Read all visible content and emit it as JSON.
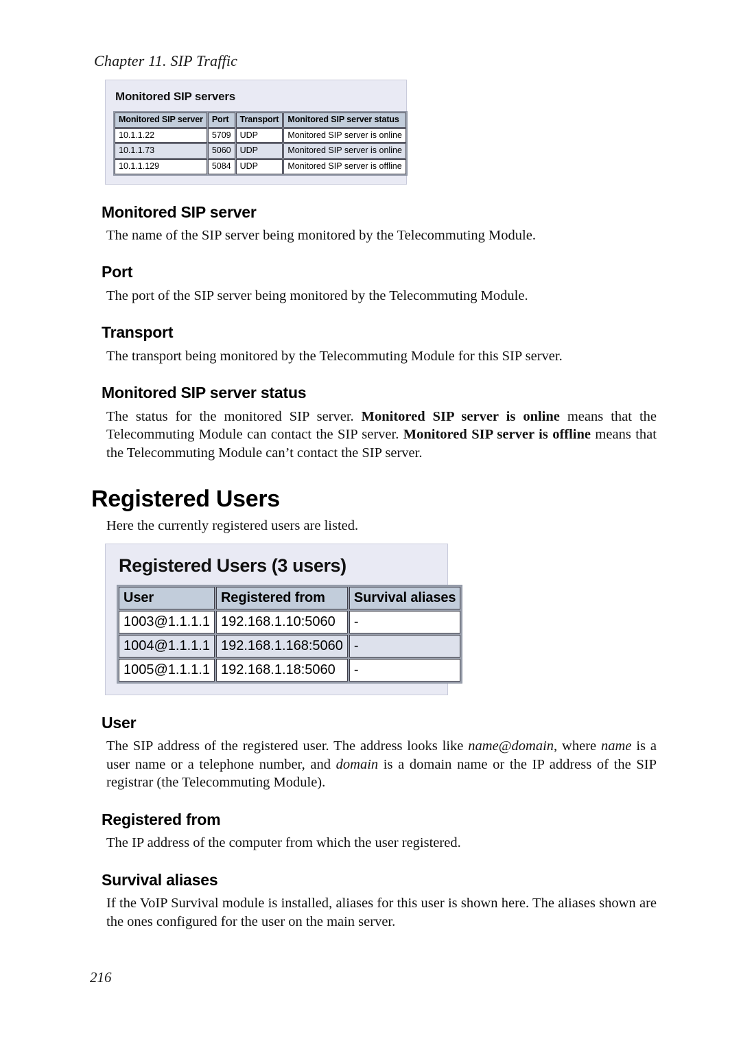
{
  "header": {
    "running_head": "Chapter 11. SIP Traffic"
  },
  "monitored_panel": {
    "title": "Monitored SIP servers",
    "columns": [
      "Monitored SIP server",
      "Port",
      "Transport",
      "Monitored SIP server status"
    ],
    "rows": [
      {
        "server": "10.1.1.22",
        "port": "5709",
        "transport": "UDP",
        "status": "Monitored SIP server is online"
      },
      {
        "server": "10.1.1.73",
        "port": "5060",
        "transport": "UDP",
        "status": "Monitored SIP server is online"
      },
      {
        "server": "10.1.1.129",
        "port": "5084",
        "transport": "UDP",
        "status": "Monitored SIP server is offline"
      }
    ]
  },
  "sections": {
    "monitored_sip_server": {
      "heading": "Monitored SIP server",
      "body": "The name of the SIP server being monitored by the Telecommuting Module."
    },
    "port": {
      "heading": "Port",
      "body": "The port of the SIP server being monitored by the Telecommuting Module."
    },
    "transport": {
      "heading": "Transport",
      "body": "The transport being monitored by the Telecommuting Module for this SIP server."
    },
    "status": {
      "heading": "Monitored SIP server status",
      "body_part1": "The status for the monitored SIP server. ",
      "body_bold1": "Monitored SIP server is online",
      "body_part2": " means that the Telecommuting Module can contact the SIP server. ",
      "body_bold2": "Monitored SIP server is offline",
      "body_part3": " means that the Telecommuting Module can’t contact the SIP server."
    },
    "registered_users": {
      "heading": "Registered Users",
      "body": "Here the currently registered users are listed."
    },
    "user": {
      "heading": "User",
      "body_part1": "The SIP address of the registered user. The address looks like ",
      "body_italic1": "name@domain",
      "body_part2": ", where ",
      "body_italic2": "name",
      "body_part3": " is a user name or a telephone number, and ",
      "body_italic3": "domain",
      "body_part4": " is a domain name or the IP address of the SIP registrar (the Telecommuting Module)."
    },
    "registered_from": {
      "heading": "Registered from",
      "body": "The IP address of the computer from which the user registered."
    },
    "survival_aliases": {
      "heading": "Survival aliases",
      "body": "If the VoIP Survival module is installed, aliases for this user is shown here. The aliases shown are the ones configured for the user on the main server."
    }
  },
  "registered_panel": {
    "title": "Registered Users (3 users)",
    "columns": [
      "User",
      "Registered from",
      "Survival aliases"
    ],
    "rows": [
      {
        "user": "1003@1.1.1.1",
        "from": "192.168.1.10:5060",
        "alias": "-"
      },
      {
        "user": "1004@1.1.1.1",
        "from": "192.168.1.168:5060",
        "alias": "-"
      },
      {
        "user": "1005@1.1.1.1",
        "from": "192.168.1.18:5060",
        "alias": "-"
      }
    ]
  },
  "footer": {
    "page_number": "216"
  },
  "colors": {
    "panel_background": "#e9eaf4",
    "table_header": "#c2cddb",
    "table_alt_row": "#dde1ec",
    "table_cell": "#ffffff",
    "text": "#000000"
  }
}
